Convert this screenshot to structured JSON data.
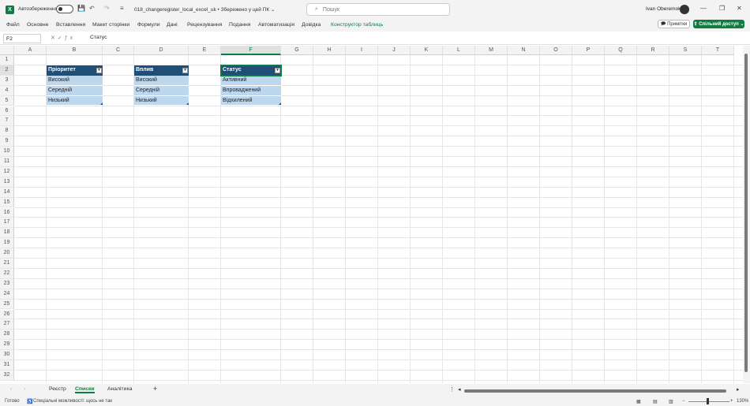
{
  "titlebar": {
    "app_icon": "X",
    "autosave_label": "Автозбереження",
    "document_title": "018_changeregister_local_excel_uk • Збережено у цей ПК ⌄",
    "search_placeholder": "Пошук",
    "user_name": "Ivan Oberemok"
  },
  "ribbon": {
    "tabs": [
      "Файл",
      "Основне",
      "Вставлення",
      "Макет сторінки",
      "Формули",
      "Дані",
      "Рецензування",
      "Подання",
      "Автоматизація",
      "Довідка",
      "Конструктор таблиць"
    ],
    "notes_label": "Примітки",
    "share_label": "Спільний доступ"
  },
  "formula_bar": {
    "name_box": "F2",
    "content": "Статус"
  },
  "grid": {
    "columns": [
      "A",
      "B",
      "C",
      "D",
      "E",
      "F",
      "G",
      "H",
      "I",
      "J",
      "K",
      "L",
      "M",
      "N",
      "O",
      "P",
      "Q",
      "R",
      "S",
      "T"
    ],
    "rows": [
      "1",
      "2",
      "3",
      "4",
      "5",
      "6",
      "7",
      "8",
      "9",
      "10",
      "11",
      "12",
      "13",
      "14",
      "15",
      "16",
      "17",
      "18",
      "19",
      "20",
      "21",
      "22",
      "23",
      "24",
      "25",
      "26",
      "27",
      "28",
      "29",
      "30",
      "31",
      "32"
    ],
    "selected_cell": "F2"
  },
  "tables": [
    {
      "header": "Пріоритет",
      "values": [
        "Високий",
        "Середній",
        "Низький"
      ]
    },
    {
      "header": "Вплив",
      "values": [
        "Високий",
        "Середній",
        "Низький"
      ]
    },
    {
      "header": "Статус",
      "values": [
        "Активний",
        "Впроваджений",
        "Відхилений"
      ]
    }
  ],
  "sheets": {
    "tabs": [
      "Реєстр",
      "Списки",
      "Аналітика"
    ],
    "active": "Списки"
  },
  "status_bar": {
    "ready": "Готово",
    "accessibility": "Спеціальні можливості: щось не так",
    "zoom": "130%"
  },
  "colors": {
    "accent": "#107c41",
    "table_header": "#1f4e79",
    "table_row": "#bdd7ee"
  }
}
